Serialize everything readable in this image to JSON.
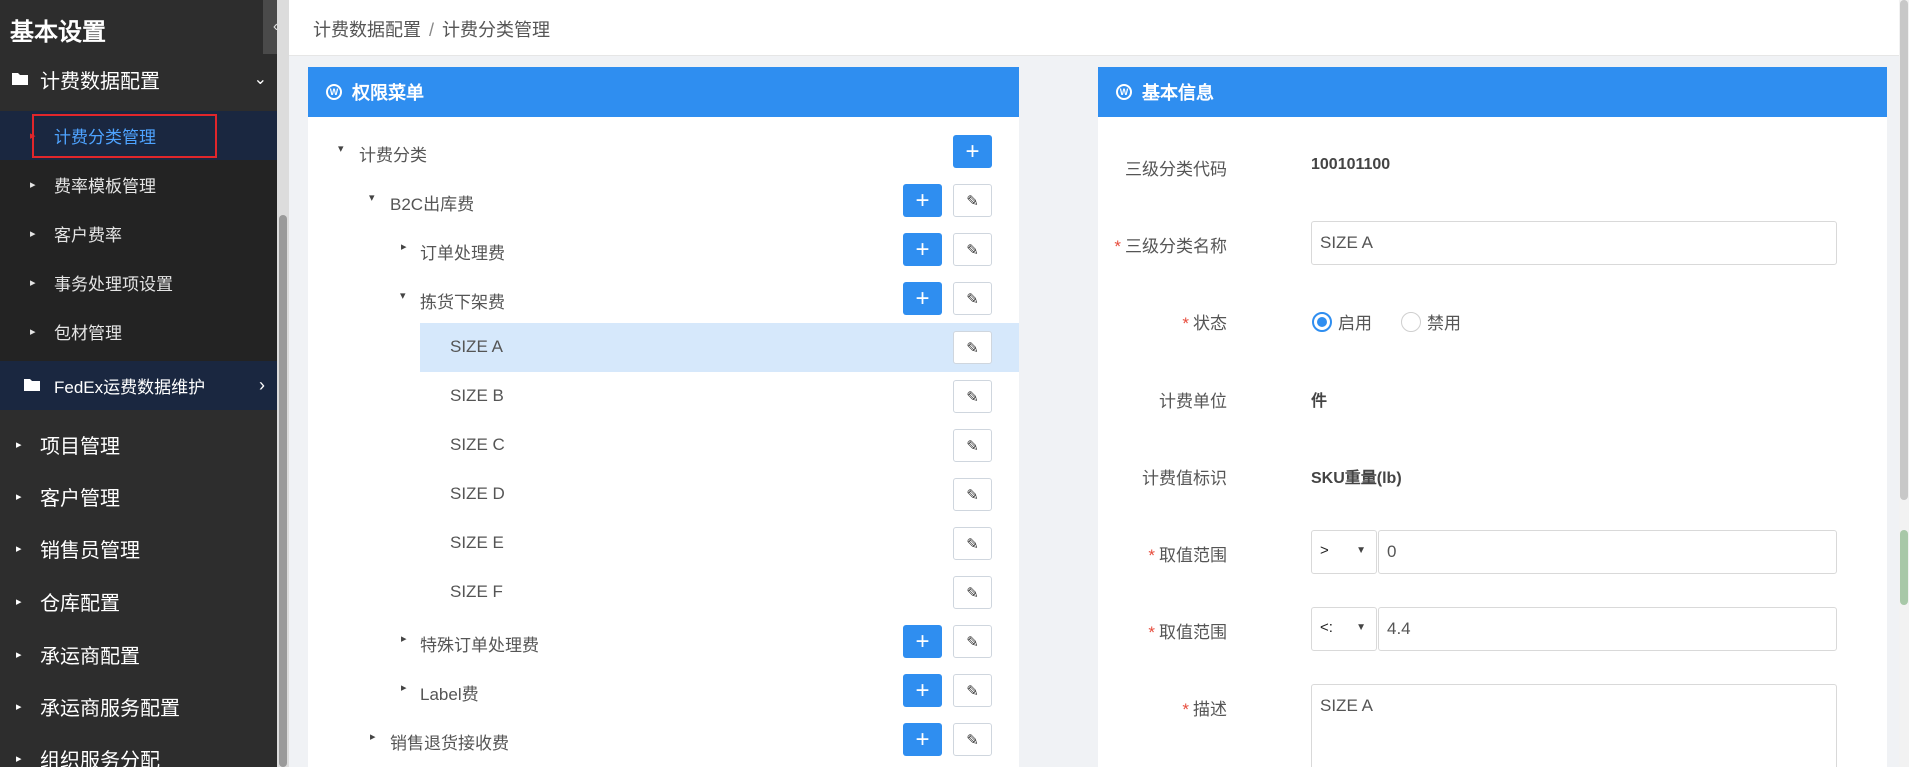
{
  "sidebar": {
    "title": "基本设置",
    "group": {
      "label": "计费数据配置"
    },
    "sub_items": [
      {
        "label": "计费分类管理"
      },
      {
        "label": "费率模板管理"
      },
      {
        "label": "客户费率"
      },
      {
        "label": "事务处理项设置"
      },
      {
        "label": "包材管理"
      }
    ],
    "fedex": {
      "label": "FedEx运费数据维护"
    },
    "main_items": [
      {
        "label": "项目管理"
      },
      {
        "label": "客户管理"
      },
      {
        "label": "销售员管理"
      },
      {
        "label": "仓库配置"
      },
      {
        "label": "承运商配置"
      },
      {
        "label": "承运商服务配置"
      },
      {
        "label": "组织服务分配"
      }
    ]
  },
  "breadcrumb": {
    "parent": "计费数据配置",
    "separator": "/",
    "current": "计费分类管理"
  },
  "left_panel": {
    "title": "权限菜单",
    "tree": [
      {
        "label": "计费分类"
      },
      {
        "label": "B2C出库费"
      },
      {
        "label": "订单处理费"
      },
      {
        "label": "拣货下架费"
      },
      {
        "label": "SIZE A"
      },
      {
        "label": "SIZE B"
      },
      {
        "label": "SIZE C"
      },
      {
        "label": "SIZE D"
      },
      {
        "label": "SIZE E"
      },
      {
        "label": "SIZE F"
      },
      {
        "label": "特殊订单处理费"
      },
      {
        "label": "Label费"
      },
      {
        "label": "销售退货接收费"
      }
    ],
    "add_glyph": "+",
    "edit_glyph": "✎"
  },
  "right_panel": {
    "title": "基本信息",
    "fields": {
      "code_label": "三级分类代码",
      "code_value": "100101100",
      "name_label": "三级分类名称",
      "name_value": "SIZE A",
      "status_label": "状态",
      "status_on": "启用",
      "status_off": "禁用",
      "unit_label": "计费单位",
      "unit_value": "件",
      "flag_label": "计费值标识",
      "flag_value": "SKU重量(lb)",
      "range1_label": "取值范围",
      "range1_op": ">",
      "range1_value": "0",
      "range2_label": "取值范围",
      "range2_op": "<:",
      "range2_value": "4.4",
      "desc_label": "描述",
      "desc_value": "SIZE A"
    },
    "required_mark": "*"
  },
  "colors": {
    "accent": "#2f8ef0",
    "sidebar_bg": "#2d2d2d",
    "selected_row": "#d6e8fb"
  }
}
